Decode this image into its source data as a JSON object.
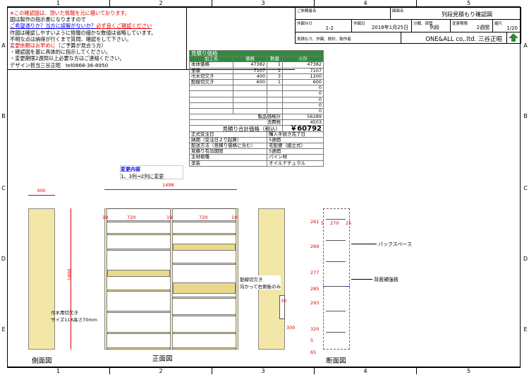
{
  "grid": {
    "columns": [
      "1",
      "2",
      "3",
      "4",
      "5"
    ],
    "rows": [
      "A",
      "B",
      "C",
      "D",
      "E"
    ]
  },
  "notes": {
    "l1": "※この確認図は、頂いた情報を元に描いております。",
    "l2": "図は製作の指示書になりますので",
    "l3a": "ご希望通りか？当方に誤解がないか？",
    "l3b": "必ず良くご確認ください",
    "l4": "作図は確認しやすいように情報の細かな数値は省略しています。",
    "l5": "不明な点は納得が行くまで質問、確認をして下さい。",
    "l6a": "変更依頼はお早めに",
    "l6b": "（ご予算が見合う方）",
    "l7": "・確認図を基に具体的に指示してください。",
    "l8": "・変更期限2週間以上必要な方はご連絡ください。",
    "l9": "デザイン担当三谷正昭　tel0868-36-8950"
  },
  "titleblock": {
    "customer_label": "ご依頼者名",
    "drawing_label": "図面名",
    "drawing_name": "列段見積もり確認図",
    "no_label": "作図ＮＯ",
    "no_value": "1-2",
    "date_label": "作図日",
    "date_value": "2018年1月25日",
    "class_label": "分類、保管",
    "class_value": "列段",
    "term_label": "変更期限",
    "term_value": "2週間",
    "scale_label": "縮尺",
    "scale_value": "1/20",
    "maker_label": "見積もり、作図、設計、製作者",
    "maker_value": "ONE&ALL co,.ltd. 三谷正昭"
  },
  "estimate": {
    "title": "見積り価格",
    "headers": [
      "加工名",
      "価格",
      "数量",
      "小計"
    ],
    "rows": [
      [
        "本体価格",
        "47382",
        "1",
        "47382"
      ],
      [
        "塗装",
        "7107",
        "1",
        "7107"
      ],
      [
        "巾木切欠き",
        "400",
        "3",
        "1200"
      ],
      [
        "配線切欠き",
        "600",
        "1",
        "600"
      ],
      [
        "",
        "",
        "",
        "0"
      ],
      [
        "",
        "",
        "",
        "0"
      ],
      [
        "",
        "",
        "",
        "0"
      ],
      [
        "",
        "",
        "",
        "0"
      ],
      [
        "",
        "",
        "",
        "0"
      ]
    ],
    "product_total_label": "製品価格計",
    "product_total": "56289",
    "tax_label": "消費税",
    "tax": "4503",
    "grand_label": "見積り合計価格（税込）",
    "grand": "￥60792",
    "info": [
      [
        "正式受注日",
        "購入手続き完了日"
      ],
      [
        "納期（受注日より起算）",
        "5週間"
      ],
      [
        "配送方法（見積り価格に含む）",
        "宅配便（組立式）"
      ],
      [
        "見積り有効期限",
        "5週間"
      ],
      [
        "主材樹種",
        "パイン材"
      ],
      [
        "塗装",
        "オイルナチュラル"
      ]
    ]
  },
  "change": {
    "title": "変更内容",
    "text": "1、3列→2列に変更"
  },
  "dims": {
    "side_depth": "300",
    "width_total": "1498",
    "height_total": "1800",
    "t19a": "19",
    "t19b": "19",
    "t19c": "19",
    "inner1": "720",
    "inner2": "720",
    "notch_w": "30",
    "notch_h": "300",
    "sec_a": "5",
    "sec_b": "270",
    "sec_c": "25",
    "v261": "261",
    "v269": "269",
    "v277": "277",
    "v285": "285",
    "v293": "293",
    "v320": "320",
    "v65": "65",
    "v5": "5"
  },
  "labels": {
    "baseboard_notch": "巾木用切欠き\nサイズ11X高さ70mm",
    "wiring_notch": "配線切欠き\n向かって右側板のみ",
    "back_space": "バックスペース",
    "back_reinforce": "背面補強板",
    "side_view": "側面図",
    "front_view": "正面図",
    "section_view": "断面図"
  },
  "colors": {
    "accent_green": "#2f8a3c",
    "wood": "#f3e7a7",
    "dim_red": "#d00000"
  }
}
